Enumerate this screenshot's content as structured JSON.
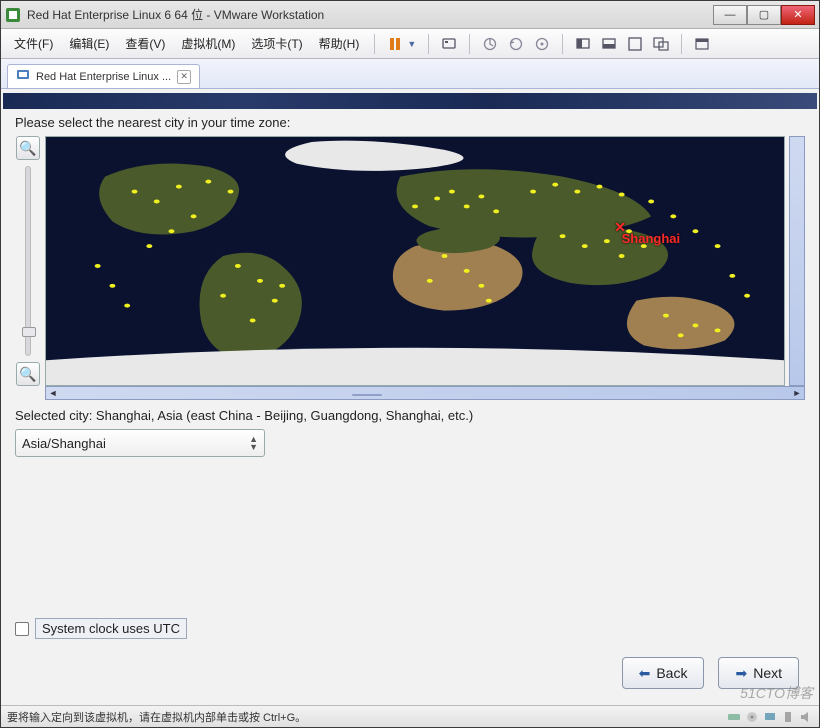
{
  "window": {
    "title": "Red Hat Enterprise Linux 6 64 位 - VMware Workstation"
  },
  "menu": {
    "file": "文件(F)",
    "edit": "编辑(E)",
    "view": "查看(V)",
    "vm": "虚拟机(M)",
    "tabs": "选项卡(T)",
    "help": "帮助(H)"
  },
  "tab": {
    "label": "Red Hat Enterprise Linux ..."
  },
  "installer": {
    "prompt": "Please select the nearest city in your time zone:",
    "selected_city_label": "Selected city: Shanghai, Asia (east China - Beijing, Guangdong, Shanghai, etc.)",
    "tz_dropdown_value": "Asia/Shanghai",
    "utc_checkbox_label": "System clock uses UTC",
    "utc_checked": false,
    "marker_label": "Shanghai",
    "back_label": "Back",
    "next_label": "Next"
  },
  "statusbar": {
    "hint": "要将输入定向到该虚拟机，请在虚拟机内部单击或按 Ctrl+G。"
  },
  "watermark": "51CTO博客"
}
